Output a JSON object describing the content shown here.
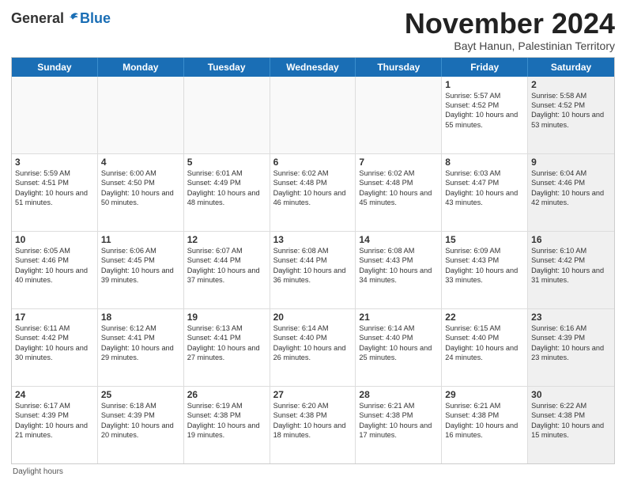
{
  "header": {
    "logo_general": "General",
    "logo_blue": "Blue",
    "month_title": "November 2024",
    "location": "Bayt Hanun, Palestinian Territory"
  },
  "days_of_week": [
    "Sunday",
    "Monday",
    "Tuesday",
    "Wednesday",
    "Thursday",
    "Friday",
    "Saturday"
  ],
  "weeks": [
    [
      {
        "day": "",
        "detail": "",
        "shaded": true
      },
      {
        "day": "",
        "detail": "",
        "shaded": true
      },
      {
        "day": "",
        "detail": "",
        "shaded": true
      },
      {
        "day": "",
        "detail": "",
        "shaded": true
      },
      {
        "day": "",
        "detail": "",
        "shaded": true
      },
      {
        "day": "1",
        "detail": "Sunrise: 5:57 AM\nSunset: 4:52 PM\nDaylight: 10 hours and 55 minutes.",
        "shaded": false
      },
      {
        "day": "2",
        "detail": "Sunrise: 5:58 AM\nSunset: 4:52 PM\nDaylight: 10 hours and 53 minutes.",
        "shaded": true
      }
    ],
    [
      {
        "day": "3",
        "detail": "Sunrise: 5:59 AM\nSunset: 4:51 PM\nDaylight: 10 hours and 51 minutes.",
        "shaded": false
      },
      {
        "day": "4",
        "detail": "Sunrise: 6:00 AM\nSunset: 4:50 PM\nDaylight: 10 hours and 50 minutes.",
        "shaded": false
      },
      {
        "day": "5",
        "detail": "Sunrise: 6:01 AM\nSunset: 4:49 PM\nDaylight: 10 hours and 48 minutes.",
        "shaded": false
      },
      {
        "day": "6",
        "detail": "Sunrise: 6:02 AM\nSunset: 4:48 PM\nDaylight: 10 hours and 46 minutes.",
        "shaded": false
      },
      {
        "day": "7",
        "detail": "Sunrise: 6:02 AM\nSunset: 4:48 PM\nDaylight: 10 hours and 45 minutes.",
        "shaded": false
      },
      {
        "day": "8",
        "detail": "Sunrise: 6:03 AM\nSunset: 4:47 PM\nDaylight: 10 hours and 43 minutes.",
        "shaded": false
      },
      {
        "day": "9",
        "detail": "Sunrise: 6:04 AM\nSunset: 4:46 PM\nDaylight: 10 hours and 42 minutes.",
        "shaded": true
      }
    ],
    [
      {
        "day": "10",
        "detail": "Sunrise: 6:05 AM\nSunset: 4:46 PM\nDaylight: 10 hours and 40 minutes.",
        "shaded": false
      },
      {
        "day": "11",
        "detail": "Sunrise: 6:06 AM\nSunset: 4:45 PM\nDaylight: 10 hours and 39 minutes.",
        "shaded": false
      },
      {
        "day": "12",
        "detail": "Sunrise: 6:07 AM\nSunset: 4:44 PM\nDaylight: 10 hours and 37 minutes.",
        "shaded": false
      },
      {
        "day": "13",
        "detail": "Sunrise: 6:08 AM\nSunset: 4:44 PM\nDaylight: 10 hours and 36 minutes.",
        "shaded": false
      },
      {
        "day": "14",
        "detail": "Sunrise: 6:08 AM\nSunset: 4:43 PM\nDaylight: 10 hours and 34 minutes.",
        "shaded": false
      },
      {
        "day": "15",
        "detail": "Sunrise: 6:09 AM\nSunset: 4:43 PM\nDaylight: 10 hours and 33 minutes.",
        "shaded": false
      },
      {
        "day": "16",
        "detail": "Sunrise: 6:10 AM\nSunset: 4:42 PM\nDaylight: 10 hours and 31 minutes.",
        "shaded": true
      }
    ],
    [
      {
        "day": "17",
        "detail": "Sunrise: 6:11 AM\nSunset: 4:42 PM\nDaylight: 10 hours and 30 minutes.",
        "shaded": false
      },
      {
        "day": "18",
        "detail": "Sunrise: 6:12 AM\nSunset: 4:41 PM\nDaylight: 10 hours and 29 minutes.",
        "shaded": false
      },
      {
        "day": "19",
        "detail": "Sunrise: 6:13 AM\nSunset: 4:41 PM\nDaylight: 10 hours and 27 minutes.",
        "shaded": false
      },
      {
        "day": "20",
        "detail": "Sunrise: 6:14 AM\nSunset: 4:40 PM\nDaylight: 10 hours and 26 minutes.",
        "shaded": false
      },
      {
        "day": "21",
        "detail": "Sunrise: 6:14 AM\nSunset: 4:40 PM\nDaylight: 10 hours and 25 minutes.",
        "shaded": false
      },
      {
        "day": "22",
        "detail": "Sunrise: 6:15 AM\nSunset: 4:40 PM\nDaylight: 10 hours and 24 minutes.",
        "shaded": false
      },
      {
        "day": "23",
        "detail": "Sunrise: 6:16 AM\nSunset: 4:39 PM\nDaylight: 10 hours and 23 minutes.",
        "shaded": true
      }
    ],
    [
      {
        "day": "24",
        "detail": "Sunrise: 6:17 AM\nSunset: 4:39 PM\nDaylight: 10 hours and 21 minutes.",
        "shaded": false
      },
      {
        "day": "25",
        "detail": "Sunrise: 6:18 AM\nSunset: 4:39 PM\nDaylight: 10 hours and 20 minutes.",
        "shaded": false
      },
      {
        "day": "26",
        "detail": "Sunrise: 6:19 AM\nSunset: 4:38 PM\nDaylight: 10 hours and 19 minutes.",
        "shaded": false
      },
      {
        "day": "27",
        "detail": "Sunrise: 6:20 AM\nSunset: 4:38 PM\nDaylight: 10 hours and 18 minutes.",
        "shaded": false
      },
      {
        "day": "28",
        "detail": "Sunrise: 6:21 AM\nSunset: 4:38 PM\nDaylight: 10 hours and 17 minutes.",
        "shaded": false
      },
      {
        "day": "29",
        "detail": "Sunrise: 6:21 AM\nSunset: 4:38 PM\nDaylight: 10 hours and 16 minutes.",
        "shaded": false
      },
      {
        "day": "30",
        "detail": "Sunrise: 6:22 AM\nSunset: 4:38 PM\nDaylight: 10 hours and 15 minutes.",
        "shaded": true
      }
    ]
  ],
  "footer": {
    "daylight_label": "Daylight hours"
  }
}
